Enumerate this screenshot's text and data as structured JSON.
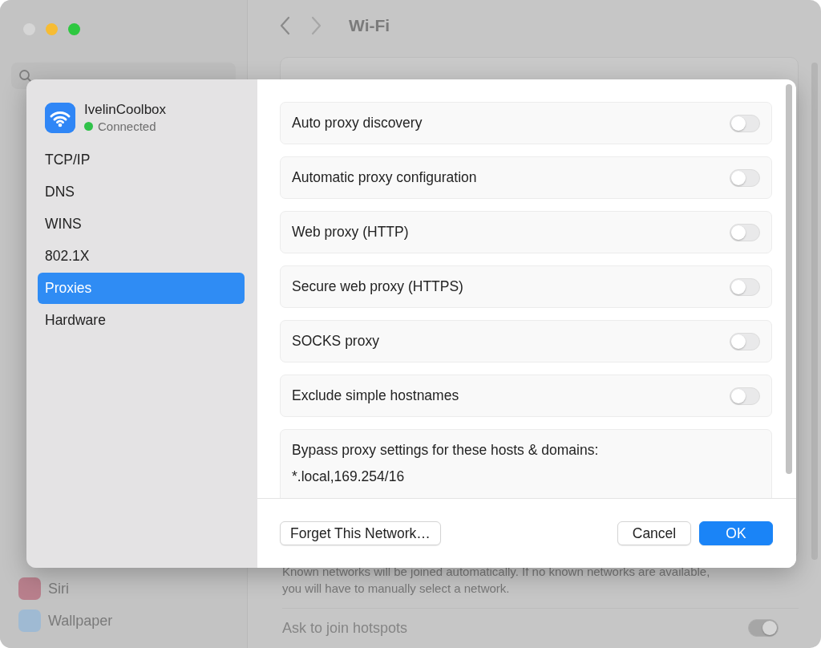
{
  "window": {
    "title": "Wi-Fi"
  },
  "background": {
    "sidebar_items": [
      {
        "label": "Siri",
        "color": "#b87f8c"
      },
      {
        "label": "Wallpaper",
        "color": "#9fbad3"
      }
    ],
    "description": "Known networks will be joined automatically. If no known networks are available, you will have to manually select a network.",
    "hotspots": {
      "label": "Ask to join hotspots",
      "on": true
    }
  },
  "sheet": {
    "network": {
      "name": "IvelinCoolbox",
      "status": "Connected",
      "color": "#30c24a"
    },
    "tabs": [
      {
        "label": "TCP/IP",
        "selected": false
      },
      {
        "label": "DNS",
        "selected": false
      },
      {
        "label": "WINS",
        "selected": false
      },
      {
        "label": "802.1X",
        "selected": false
      },
      {
        "label": "Proxies",
        "selected": true
      },
      {
        "label": "Hardware",
        "selected": false
      }
    ],
    "options": [
      {
        "label": "Auto proxy discovery",
        "on": false
      },
      {
        "label": "Automatic proxy configuration",
        "on": false
      },
      {
        "label": "Web proxy (HTTP)",
        "on": false
      },
      {
        "label": "Secure web proxy (HTTPS)",
        "on": false
      },
      {
        "label": "SOCKS proxy",
        "on": false
      },
      {
        "label": "Exclude simple hostnames",
        "on": false
      }
    ],
    "bypass": {
      "label": "Bypass proxy settings for these hosts & domains:",
      "value": "*.local,169.254/16"
    },
    "buttons": [
      {
        "label": "Forget This Network…",
        "kind": "secondary"
      },
      {
        "label": "Cancel",
        "kind": "secondary"
      },
      {
        "label": "OK",
        "kind": "primary"
      }
    ]
  }
}
